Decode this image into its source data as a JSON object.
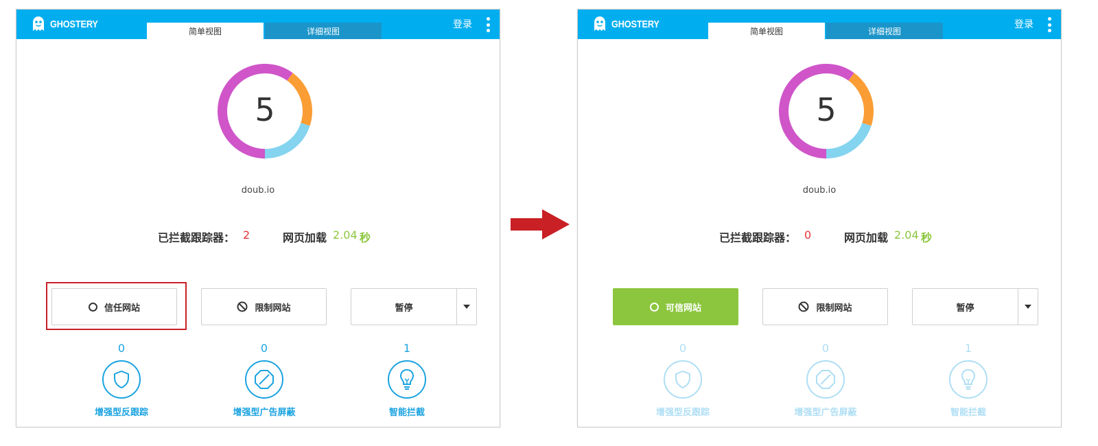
{
  "colors": {
    "header_blue": "#00aef0",
    "tab_detail_blue": "#1b95c9",
    "donut_purple": "#cf55c9",
    "donut_orange": "#fb9d35",
    "donut_lightblue": "#84d4ef",
    "blocked_red": "#e33338",
    "load_green": "#8cc63e",
    "feature_blue": "#1aa3e0",
    "arrow_red": "#c82025",
    "trusted_green": "#8cc63e"
  },
  "icons": {
    "brand": "ghost-logo-icon",
    "menu": "kebab-menu-icon",
    "trust": "circle-icon",
    "restrict": "ban-icon",
    "dropdown": "caret-down-icon",
    "anti_tracking": "shield-icon",
    "ad_blocking": "ban-octagon-icon",
    "smart_blocking": "lightbulb-icon",
    "transition": "right-arrow-icon"
  },
  "left": {
    "brand": "GHOSTERY",
    "tabs": {
      "simple": "简单视图",
      "detail": "详细视图"
    },
    "login": "登录",
    "tracker_count": "5",
    "donut_segments": [
      {
        "name": "purple",
        "fraction": 0.6
      },
      {
        "name": "orange",
        "fraction": 0.2
      },
      {
        "name": "lightblue",
        "fraction": 0.2
      }
    ],
    "domain": "doub.io",
    "blocked_label": "已拦截跟踪器：",
    "blocked_count": "2",
    "load_label": "网页加载",
    "load_time": "2.04",
    "load_unit": "秒",
    "trust_label": "信任网站",
    "restrict_label": "限制网站",
    "pause_label": "暂停",
    "features": [
      {
        "count": "0",
        "label": "增强型反跟踪"
      },
      {
        "count": "0",
        "label": "增强型广告屏蔽"
      },
      {
        "count": "1",
        "label": "智能拦截"
      }
    ]
  },
  "right": {
    "brand": "GHOSTERY",
    "tabs": {
      "simple": "简单视图",
      "detail": "详细视图"
    },
    "login": "登录",
    "tracker_count": "5",
    "domain": "doub.io",
    "blocked_label": "已拦截跟踪器：",
    "blocked_count": "0",
    "load_label": "网页加载",
    "load_time": "2.04",
    "load_unit": "秒",
    "trust_label": "可信网站",
    "restrict_label": "限制网站",
    "pause_label": "暂停",
    "features": [
      {
        "count": "0",
        "label": "增强型反跟踪"
      },
      {
        "count": "0",
        "label": "增强型广告屏蔽"
      },
      {
        "count": "1",
        "label": "智能拦截"
      }
    ]
  }
}
